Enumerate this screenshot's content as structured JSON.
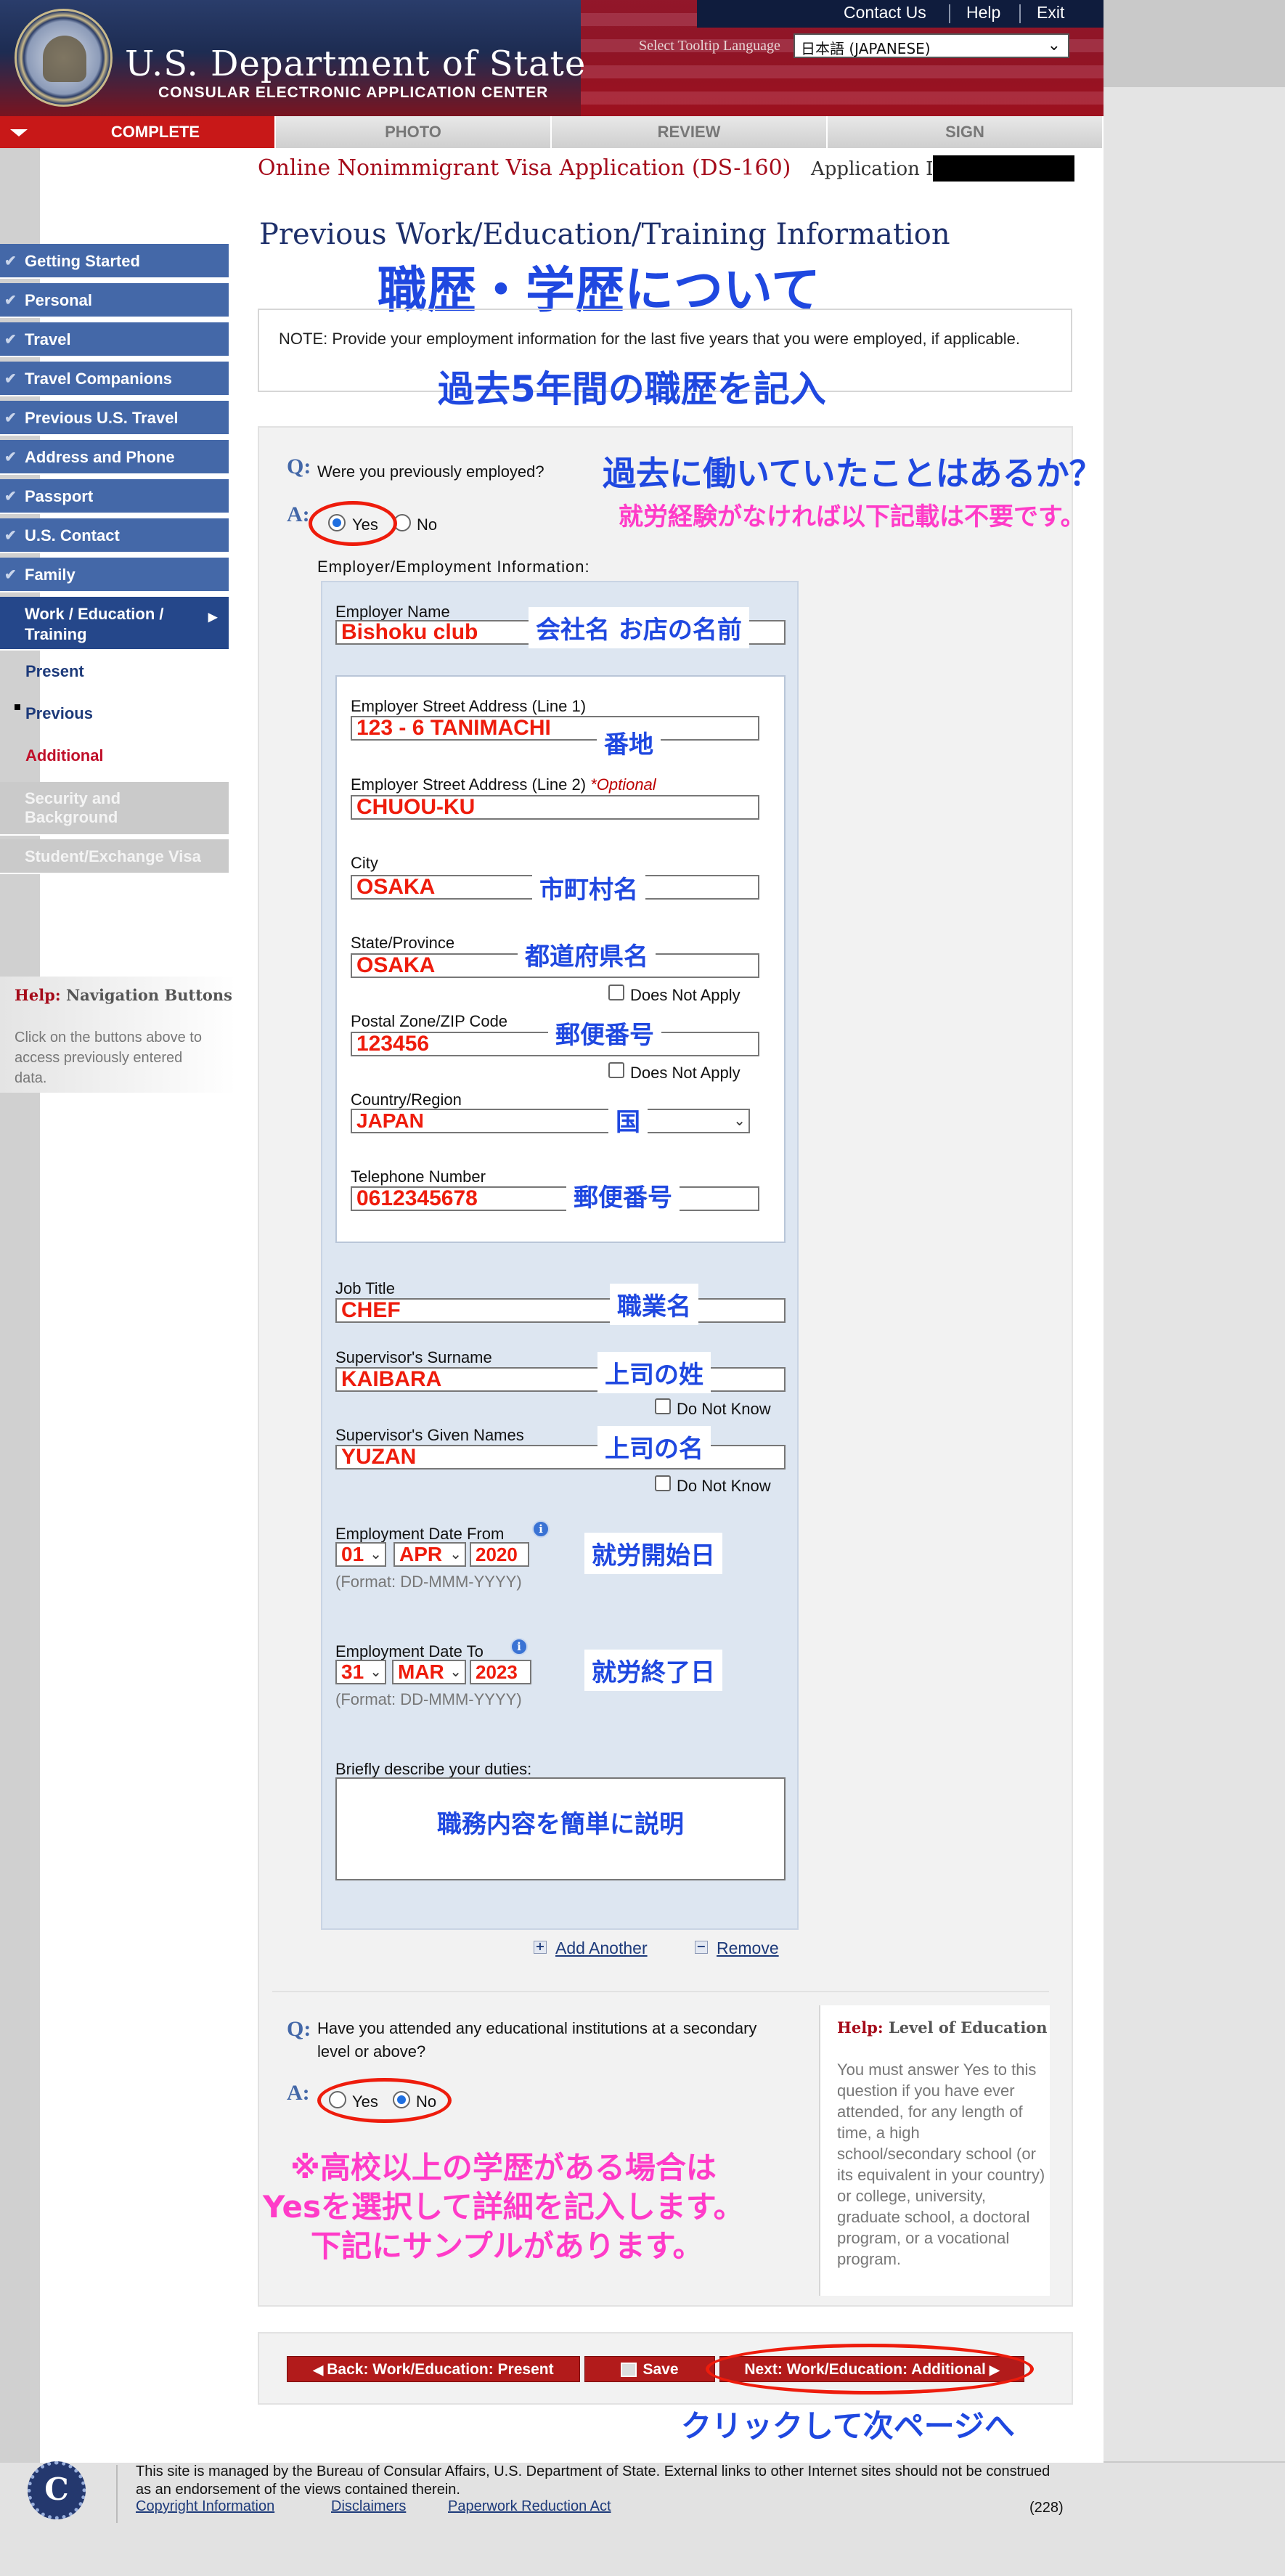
{
  "header": {
    "util_links": [
      "Contact Us",
      "Help",
      "Exit"
    ],
    "dept_title": "U.S. Department of State",
    "dept_subtitle": "CONSULAR ELECTRONIC APPLICATION CENTER",
    "lang_label": "Select Tooltip Language",
    "lang_value": "日本語 (JAPANESE)"
  },
  "tabs": [
    "COMPLETE",
    "PHOTO",
    "REVIEW",
    "SIGN"
  ],
  "form": {
    "title": "Online Nonimmigrant Visa Application (DS-160)",
    "app_id_label": "Application ID"
  },
  "sidebar": {
    "items": [
      "Getting Started",
      "Personal",
      "Travel",
      "Travel Companions",
      "Previous U.S. Travel",
      "Address and Phone",
      "Passport",
      "U.S. Contact",
      "Family"
    ],
    "current": "Work / Education / Training",
    "subitems": [
      "Present",
      "Previous",
      "Additional"
    ],
    "disabled": [
      "Security and Background",
      "Student/Exchange Visa"
    ],
    "help_title_prefix": "Help:",
    "help_title": "Navigation Buttons",
    "help_text": "Click on the buttons above to access previously entered data."
  },
  "page": {
    "heading": "Previous Work/Education/Training Information",
    "heading_ja": "職歴・学歴について",
    "note": "NOTE: Provide your employment information for the last five years that you were employed, if applicable.",
    "note_ja": "過去5年間の職歴を記入",
    "q1_mark": "Q:",
    "a_mark": "A:",
    "q1": "Were you previously employed?",
    "q1_ja": "過去に働いていたことはあるか？",
    "q1_note_ja": "就労経験がなければ以下記載は不要です。",
    "yes": "Yes",
    "no": "No",
    "employer_section": "Employer/Employment Information:"
  },
  "employer": {
    "name_label": "Employer Name",
    "name_value": "Bishoku club",
    "name_tag": "会社名 お店の名前",
    "addr1_label": "Employer Street Address (Line 1)",
    "addr1_value": "123 - 6 TANIMACHI",
    "addr1_tag": "番地",
    "addr2_label": "Employer Street Address (Line 2)",
    "addr2_optional": "*Optional",
    "addr2_value": "CHUOU-KU",
    "city_label": "City",
    "city_value": "OSAKA",
    "city_tag": "市町村名",
    "state_label": "State/Province",
    "state_value": "OSAKA",
    "state_tag": "都道府県名",
    "does_not_apply": "Does Not Apply",
    "postal_label": "Postal Zone/ZIP Code",
    "postal_value": "123456",
    "postal_tag": "郵便番号",
    "country_label": "Country/Region",
    "country_value": "JAPAN",
    "country_tag": "国",
    "phone_label": "Telephone Number",
    "phone_value": "0612345678",
    "phone_tag": "郵便番号",
    "job_label": "Job Title",
    "job_value": "CHEF",
    "job_tag": "職業名",
    "sup_surname_label": "Supervisor's Surname",
    "sup_surname_value": "KAIBARA",
    "sup_surname_tag": "上司の姓",
    "do_not_know": "Do Not Know",
    "sup_given_label": "Supervisor's Given Names",
    "sup_given_value": "YUZAN",
    "sup_given_tag": "上司の名",
    "date_from_label": "Employment Date From",
    "from_day": "01",
    "from_month": "APR",
    "from_year": "2020",
    "date_from_tag": "就労開始日",
    "date_format": "(Format: DD-MMM-YYYY)",
    "date_to_label": "Employment Date To",
    "to_day": "31",
    "to_month": "MAR",
    "to_year": "2023",
    "date_to_tag": "就労終了日",
    "duties_label": "Briefly describe your duties:",
    "duties_tag": "職務内容を簡単に説明",
    "add_another": "Add Another",
    "remove": "Remove"
  },
  "education": {
    "question": "Have you attended any educational institutions at a secondary level or above?",
    "note_ja_1": "※高校以上の学歴がある場合は",
    "note_ja_2": "Yesを選択して詳細を記入します。",
    "note_ja_3": "下記にサンプルがあります。",
    "help_title_prefix": "Help:",
    "help_title": "Level of Education",
    "help_text": "You must answer Yes to this question if you have ever attended, for any length of time, a high school/secondary school (or its equivalent in your country) or college, university, graduate school, a doctoral program, or a vocational program."
  },
  "buttons": {
    "back": "Back: Work/Education: Present",
    "save": "Save",
    "next": "Next: Work/Education: Additional",
    "next_note_ja": "クリックして次ページへ"
  },
  "footer": {
    "text": "This site is managed by the Bureau of Consular Affairs, U.S. Department of State. External links to other Internet sites should not be construed as an endorsement of the views contained therein.",
    "links": [
      "Copyright Information",
      "Disclaimers",
      "Paperwork Reduction Act"
    ],
    "count": "(228)"
  },
  "colors": {
    "brand_blue": "#4468a8",
    "brand_red": "#b21b1b",
    "annotation_blue": "#1f48e0",
    "annotation_pink": "#ff3bc8",
    "annotation_red": "#ee1c0c"
  }
}
